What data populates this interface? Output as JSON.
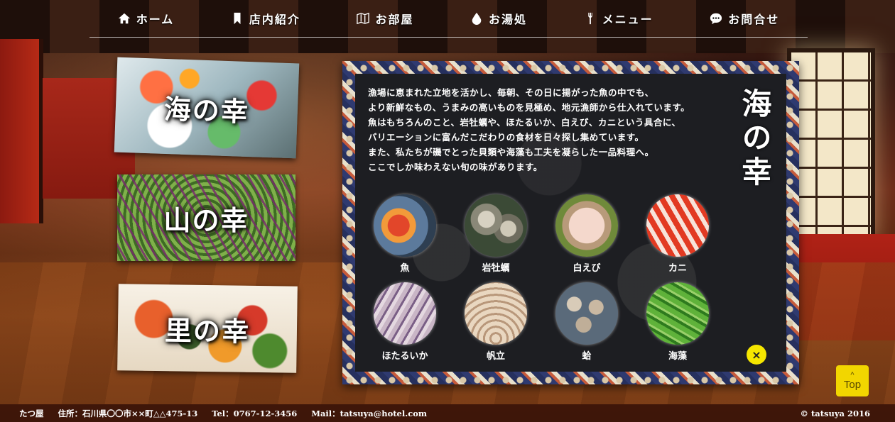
{
  "nav": {
    "items": [
      {
        "label": "ホーム",
        "icon": "home-icon"
      },
      {
        "label": "店内紹介",
        "icon": "bookmark-icon"
      },
      {
        "label": "お部屋",
        "icon": "map-icon"
      },
      {
        "label": "お湯処",
        "icon": "drop-icon"
      },
      {
        "label": "メニュー",
        "icon": "fork-icon"
      },
      {
        "label": "お問合せ",
        "icon": "chat-icon"
      }
    ]
  },
  "categories": [
    {
      "label": "海の幸"
    },
    {
      "label": "山の幸"
    },
    {
      "label": "里の幸"
    }
  ],
  "panel": {
    "title": "海の幸",
    "paragraphs": [
      "漁場に恵まれた立地を活かし、毎朝、その日に揚がった魚の中でも、",
      "より新鮮なもの、うまみの高いものを見極め、地元漁師から仕入れています。",
      "魚はもちろんのこと、岩牡蠣や、ほたるいか、白えび、カニという具合に、",
      "バリエーションに富んだこだわりの食材を日々探し集めています。",
      "また、私たちが磯でとった貝類や海藻も工夫を凝らした一品料理へ。",
      "ここでしか味わえない旬の味があります。"
    ],
    "items": [
      {
        "label": "魚"
      },
      {
        "label": "岩牡蠣"
      },
      {
        "label": "白えび"
      },
      {
        "label": "カニ"
      },
      {
        "label": "ほたるいか"
      },
      {
        "label": "帆立"
      },
      {
        "label": "蛤"
      },
      {
        "label": "海藻"
      }
    ],
    "close_label": "×"
  },
  "top_button": {
    "label": "Top"
  },
  "footer": {
    "shop": "たつ屋",
    "address": "住所：石川県〇〇市××町△△475-13",
    "tel": "Tel：0767-12-3456",
    "mail": "Mail：tatsuya@hotel.com",
    "copyright": "© tatsuya 2016"
  },
  "colors": {
    "accent_yellow": "#f5e600",
    "panel_bg": "#1d1e22",
    "nav_text": "#ffffff"
  }
}
